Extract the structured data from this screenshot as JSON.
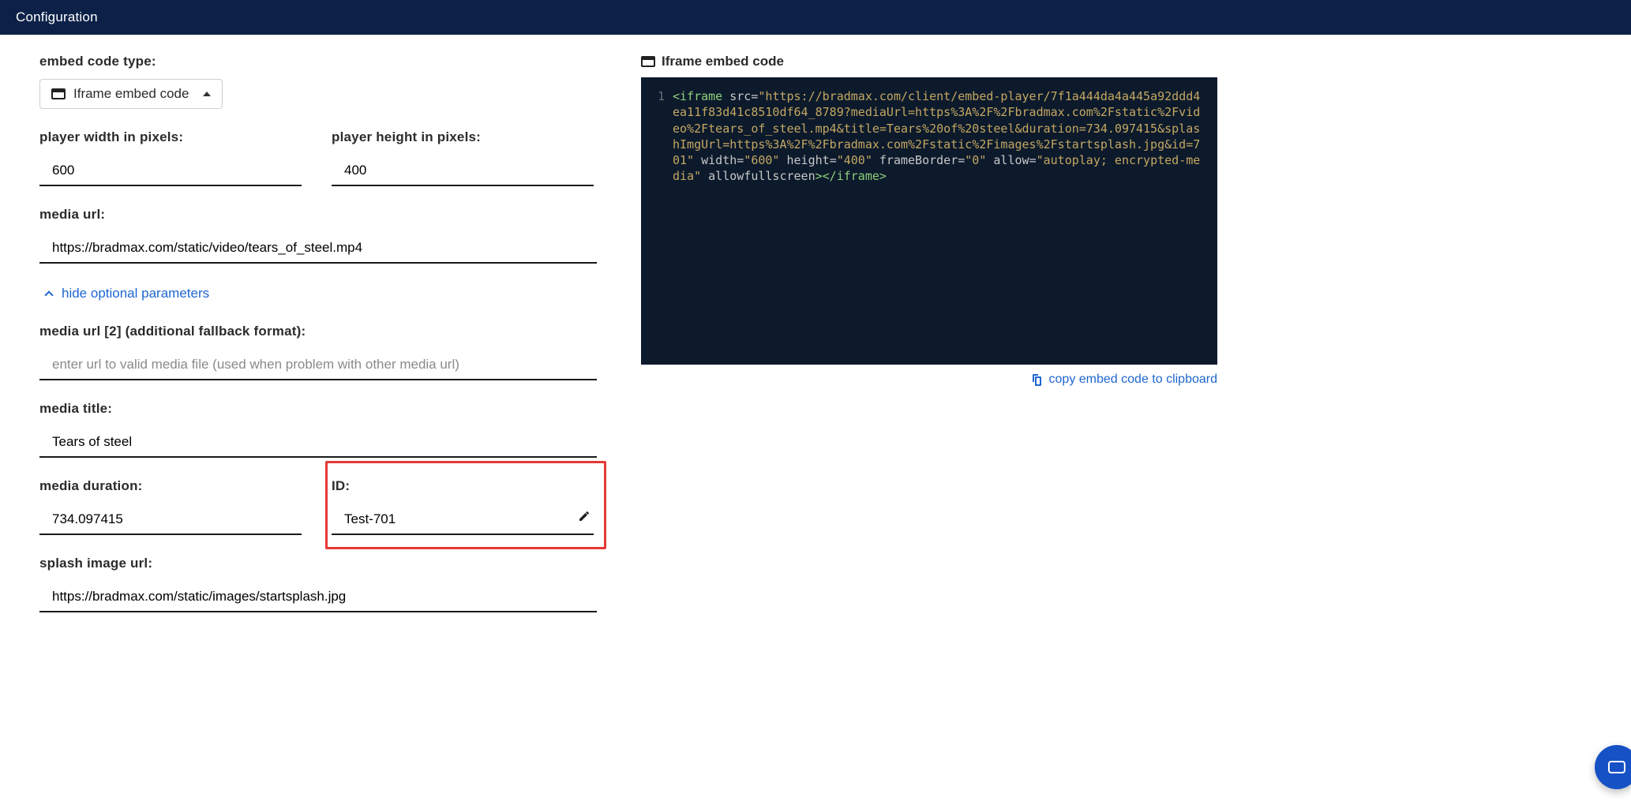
{
  "header": {
    "title": "Configuration"
  },
  "left": {
    "embed_type_label": "embed code type:",
    "embed_type_selected": "Iframe embed code",
    "width_label": "player width in pixels:",
    "width_value": "600",
    "height_label": "player height in pixels:",
    "height_value": "400",
    "media_url_label": "media url:",
    "media_url_value": "https://bradmax.com/static/video/tears_of_steel.mp4",
    "toggle_optional": "hide optional parameters",
    "media_url2_label": "media url [2] (additional fallback format):",
    "media_url2_placeholder": "enter url to valid media file (used when problem with other media url)",
    "media_title_label": "media title:",
    "media_title_value": "Tears of steel",
    "duration_label": "media duration:",
    "duration_value": "734.097415",
    "id_label": "ID:",
    "id_value": "Test-701",
    "splash_label": "splash image url:",
    "splash_value": "https://bradmax.com/static/images/startsplash.jpg"
  },
  "right": {
    "title": "Iframe embed code",
    "line_no": "1",
    "code": {
      "p1": "<iframe",
      "attr_src": "src",
      "src_val": "\"https://bradmax.com/client/embed-player/7f1a444da4a445a92ddd4ea11f83d41c8510df64_8789?mediaUrl=https%3A%2F%2Fbradmax.com%2Fstatic%2Fvideo%2Ftears_of_steel.mp4&title=Tears%20of%20steel&duration=734.097415&splashImgUrl=https%3A%2F%2Fbradmax.com%2Fstatic%2Fimages%2Fstartsplash.jpg&id=701\"",
      "attr_w": "width",
      "w_val": "\"600\"",
      "attr_h": "height",
      "h_val": "\"400\"",
      "attr_fb": "frameBorder",
      "fb_val": "\"0\"",
      "attr_allow": "allow",
      "allow_val": "\"autoplay; encrypted-media\"",
      "attr_afs": "allowfullscreen",
      "close": "></iframe>"
    },
    "copy_label": "copy embed code to clipboard"
  }
}
